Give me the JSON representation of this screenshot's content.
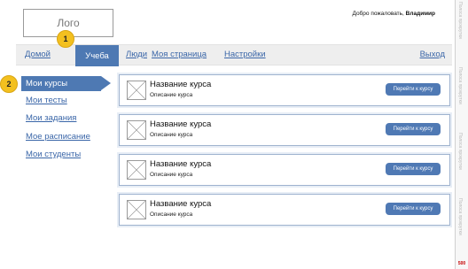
{
  "header": {
    "logo_label": "Лого",
    "welcome_prefix": "Добро пожаловать, ",
    "user_name": "Владимир"
  },
  "nav": {
    "home": "Домой",
    "study": "Учеба",
    "people": "Люди",
    "my_page": "Моя страница",
    "settings": "Настройки",
    "logout": "Выход"
  },
  "markers": [
    "1",
    "2"
  ],
  "sidebar": {
    "items": [
      {
        "label": "Мои курсы"
      },
      {
        "label": "Мои тесты"
      },
      {
        "label": "Мои задания"
      },
      {
        "label": "Мое расписание"
      },
      {
        "label": "Мои студенты"
      }
    ]
  },
  "courses": [
    {
      "title": "Название курса",
      "description": "Описание курса",
      "button": "Перейти к курсу"
    },
    {
      "title": "Название курса",
      "description": "Описание курса",
      "button": "Перейти к курсу"
    },
    {
      "title": "Название курса",
      "description": "Описание курса",
      "button": "Перейти к курсу"
    },
    {
      "title": "Название курса",
      "description": "Описание курса",
      "button": "Перейти к курсу"
    }
  ],
  "rail": {
    "labels": [
      "Полоса прокрутки",
      "Полоса прокрутки",
      "Полоса прокрутки",
      "Полоса прокрутки"
    ],
    "badge": "500"
  },
  "colors": {
    "accent": "#4e79b3",
    "link": "#3a66a8",
    "marker": "#f3c01f"
  }
}
